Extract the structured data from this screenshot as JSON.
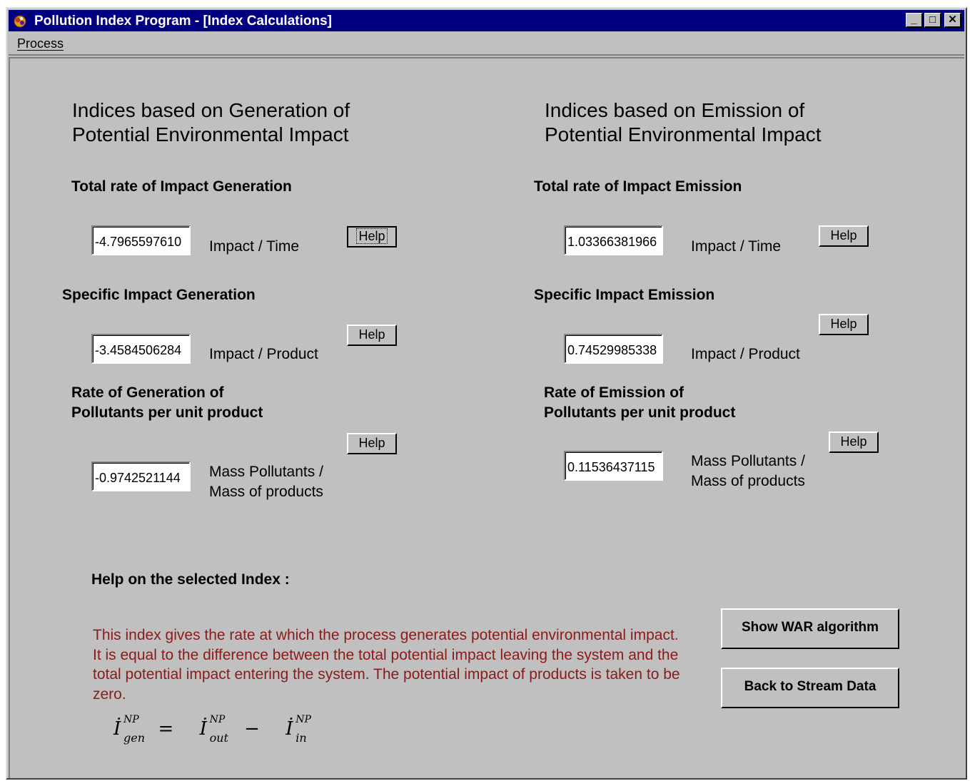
{
  "window": {
    "title": "Pollution Index Program - [Index Calculations]",
    "minimize": "_",
    "maximize": "□",
    "close": "✕"
  },
  "menu": {
    "process": "Process"
  },
  "left": {
    "heading_line1": "Indices based on Generation of",
    "heading_line2": "Potential Environmental Impact",
    "total_rate_label": "Total rate of Impact Generation",
    "total_rate_value": "-4.7965597610",
    "total_rate_unit": "Impact / Time",
    "specific_label": "Specific Impact Generation",
    "specific_value": "-3.4584506284",
    "specific_unit": "Impact / Product",
    "rate_pollutants_line1": "Rate of Generation of",
    "rate_pollutants_line2": "Pollutants per unit product",
    "rate_pollutants_value": "-0.9742521144",
    "rate_pollutants_unit_line1": "Mass Pollutants /",
    "rate_pollutants_unit_line2": "Mass of products"
  },
  "right": {
    "heading_line1": "Indices based on Emission of",
    "heading_line2": "Potential Environmental Impact",
    "total_rate_label": "Total rate of Impact Emission",
    "total_rate_value": "1.03366381966",
    "total_rate_unit": "Impact / Time",
    "specific_label": "Specific Impact Emission",
    "specific_value": "0.74529985338",
    "specific_unit": "Impact / Product",
    "rate_pollutants_line1": "Rate of Emission of",
    "rate_pollutants_line2": "Pollutants per unit product",
    "rate_pollutants_value": "0.11536437115",
    "rate_pollutants_unit_line1": "Mass Pollutants /",
    "rate_pollutants_unit_line2": "Mass of products"
  },
  "help_button_label": "Help",
  "help_section": {
    "title": "Help on the selected Index :",
    "text": "This index gives the rate at which the process generates potential environmental impact. It is equal to the difference between the total potential impact leaving the system and the total potential impact entering the system. The potential impact of products is taken to be zero.",
    "text_color": "#8b1a1a"
  },
  "formula": {
    "base": "İ",
    "superscript": "NP",
    "sub_gen": "gen",
    "sub_out": "out",
    "sub_in": "in",
    "equals": "=",
    "minus": "−"
  },
  "buttons": {
    "show_war": "Show WAR algorithm",
    "back_stream": "Back to Stream Data"
  },
  "colors": {
    "titlebar": "#000080",
    "face": "#c0c0c0"
  }
}
